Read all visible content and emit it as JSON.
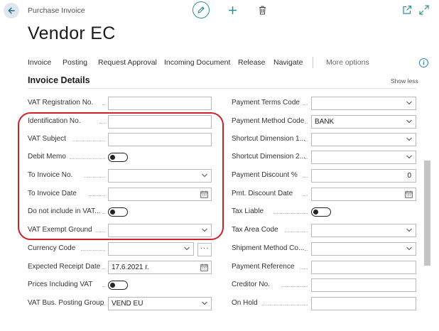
{
  "header": {
    "breadcrumb": "Purchase Invoice",
    "title": "Vendor EC"
  },
  "actions": [
    {
      "label": "Invoice"
    },
    {
      "label": "Posting"
    },
    {
      "label": "Request Approval"
    },
    {
      "label": "Incoming Document"
    },
    {
      "label": "Release"
    },
    {
      "label": "Navigate"
    },
    {
      "label": "More options"
    }
  ],
  "info_glyph": "i",
  "section": {
    "title": "Invoice Details",
    "toggle_label": "Show less"
  },
  "left_fields": [
    {
      "label": "VAT Registration No.",
      "value": "",
      "type": "text"
    },
    {
      "label": "Identification No.",
      "value": "",
      "type": "text"
    },
    {
      "label": "VAT Subject",
      "value": "",
      "type": "text"
    },
    {
      "label": "Debit Memo",
      "value": "off",
      "type": "toggle"
    },
    {
      "label": "To Invoice No.",
      "value": "",
      "type": "select"
    },
    {
      "label": "To Invoice Date",
      "value": "",
      "type": "date"
    },
    {
      "label": "Do not include in VAT...",
      "value": "off",
      "type": "toggle"
    },
    {
      "label": "VAT Exempt Ground",
      "value": "",
      "type": "select"
    },
    {
      "label": "Currency Code",
      "value": "",
      "type": "select-assist",
      "assist_label": "···"
    },
    {
      "label": "Expected Receipt Date",
      "value": "17.6.2021 г.",
      "type": "date"
    },
    {
      "label": "Prices Including VAT",
      "value": "off",
      "type": "toggle"
    },
    {
      "label": "VAT Bus. Posting Group",
      "value": "VEND EU",
      "type": "select"
    }
  ],
  "right_fields": [
    {
      "label": "Payment Terms Code",
      "value": "",
      "type": "select"
    },
    {
      "label": "Payment Method Code",
      "value": "BANK",
      "type": "select"
    },
    {
      "label": "Shortcut Dimension 1...",
      "value": "",
      "type": "select"
    },
    {
      "label": "Shortcut Dimension 2...",
      "value": "",
      "type": "select"
    },
    {
      "label": "Payment Discount %",
      "value": "0",
      "type": "number"
    },
    {
      "label": "Pmt. Discount Date",
      "value": "",
      "type": "date"
    },
    {
      "label": "Tax Liable",
      "value": "off",
      "type": "toggle"
    },
    {
      "label": "Tax Area Code",
      "value": "",
      "type": "select"
    },
    {
      "label": "Shipment Method Co...",
      "value": "",
      "type": "select"
    },
    {
      "label": "Payment Reference",
      "value": "",
      "type": "text"
    },
    {
      "label": "Creditor No.",
      "value": "",
      "type": "text"
    },
    {
      "label": "On Hold",
      "value": "",
      "type": "text"
    }
  ],
  "colors": {
    "accent": "#2a8f8f",
    "highlight": "#d11f2a",
    "back_button_bg": "#dfe7ee"
  },
  "icons": [
    "back-arrow-icon",
    "edit-pencil-icon",
    "plus-icon",
    "trash-icon",
    "open-new-window-icon",
    "expand-icon",
    "info-icon",
    "chevron-down-icon",
    "calendar-icon"
  ]
}
